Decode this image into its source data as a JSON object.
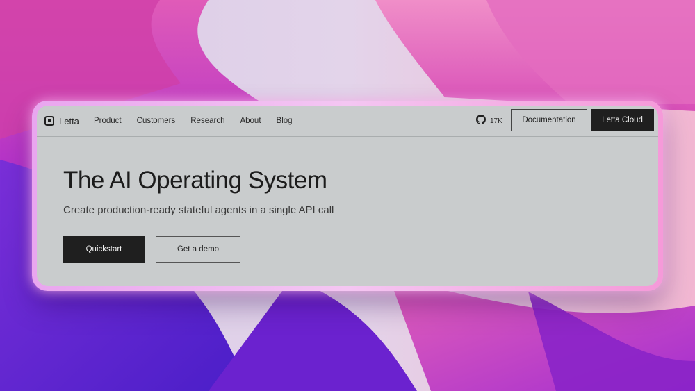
{
  "brand": {
    "name": "Letta",
    "icon": "letta-logo-icon"
  },
  "nav": {
    "items": [
      {
        "label": "Product"
      },
      {
        "label": "Customers"
      },
      {
        "label": "Research"
      },
      {
        "label": "About"
      },
      {
        "label": "Blog"
      }
    ]
  },
  "github": {
    "icon": "github-icon",
    "stars": "17K"
  },
  "actions": {
    "documentation_label": "Documentation",
    "cloud_label": "Letta Cloud"
  },
  "hero": {
    "title": "The AI Operating System",
    "subtitle": "Create production-ready stateful agents in a single API call",
    "primary_cta": "Quickstart",
    "secondary_cta": "Get a demo"
  },
  "colors": {
    "window_bg": "#c9cccd",
    "dark_button": "#1f1f1f",
    "frame_glow": "#f4c6f2",
    "wallpaper_magenta": "#c02bb8",
    "wallpaper_violet": "#5a22d6"
  }
}
